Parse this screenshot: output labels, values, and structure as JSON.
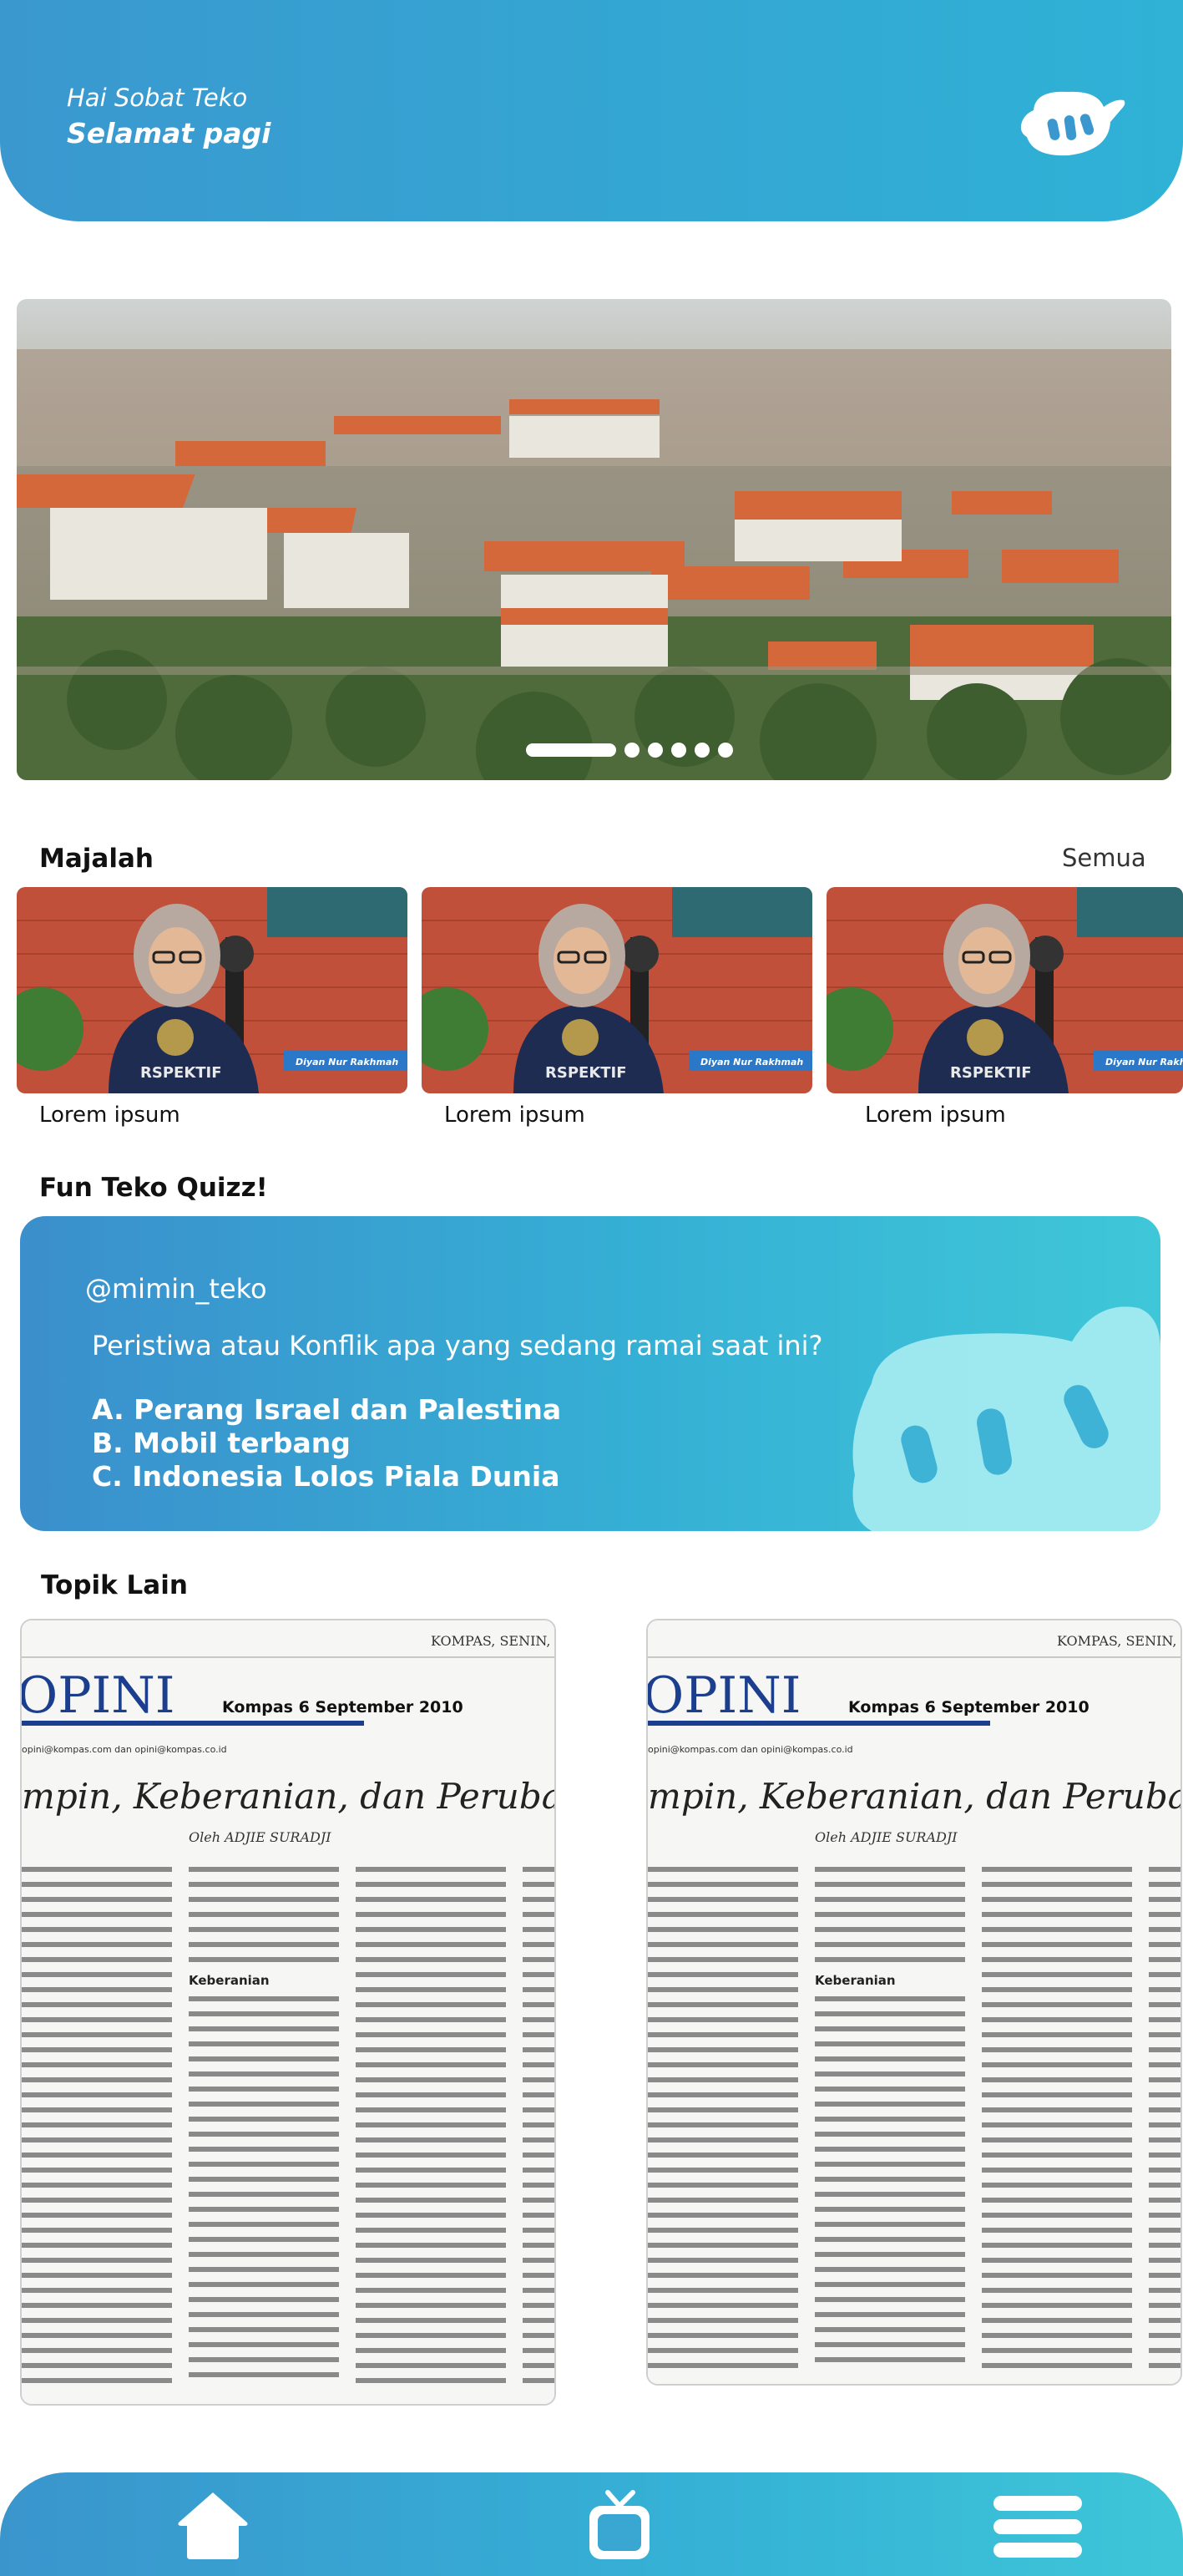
{
  "header": {
    "greeting": "Hai Sobat Teko",
    "salutation": "Selamat pagi"
  },
  "banner": {
    "slide_count": 6,
    "active_slide": 1
  },
  "majalah": {
    "title": "Majalah",
    "see_all": "Semua",
    "items": [
      {
        "caption": "Lorem ipsum",
        "speaker": "Diyan Nur Rakhmah"
      },
      {
        "caption": "Lorem ipsum",
        "speaker": "Diyan Nur Rakhmah"
      },
      {
        "caption": "Lorem ipsum",
        "speaker": "Diyan Nur Rakhmah"
      }
    ]
  },
  "quiz": {
    "title": "Fun Teko Quizz!",
    "handle": "@mimin_teko",
    "question": "Peristiwa atau Konflik apa yang sedang ramai saat ini?",
    "options": [
      "A. Perang Israel dan Palestina",
      "B. Mobil terbang",
      "C. Indonesia Lolos Piala Dunia"
    ]
  },
  "topik": {
    "title": "Topik Lain",
    "items": [
      {
        "masthead": "KOMPAS, SENIN,",
        "section": "OPINI",
        "date": "Kompas 6 September 2010",
        "email": "opini@kompas.com dan opini@kompas.co.id",
        "headline": "mpin, Keberanian, dan Perubah",
        "byline": "Oleh ADJIE SURADJI",
        "subhead": "Keberanian"
      },
      {
        "masthead": "KOMPAS, SENIN,",
        "section": "OPINI",
        "date": "Kompas 6 September 2010",
        "email": "opini@kompas.com dan opini@kompas.co.id",
        "headline": "mpin, Keberanian, dan Perubah",
        "byline": "Oleh ADJIE SURADJI",
        "subhead": "Keberanian"
      }
    ]
  },
  "nav": {
    "items": [
      "home-icon",
      "tv-icon",
      "menu-icon"
    ]
  },
  "colors": {
    "primary": "#3a98cf",
    "accent": "#2fb2d6",
    "light_accent": "#a8ecf2"
  }
}
